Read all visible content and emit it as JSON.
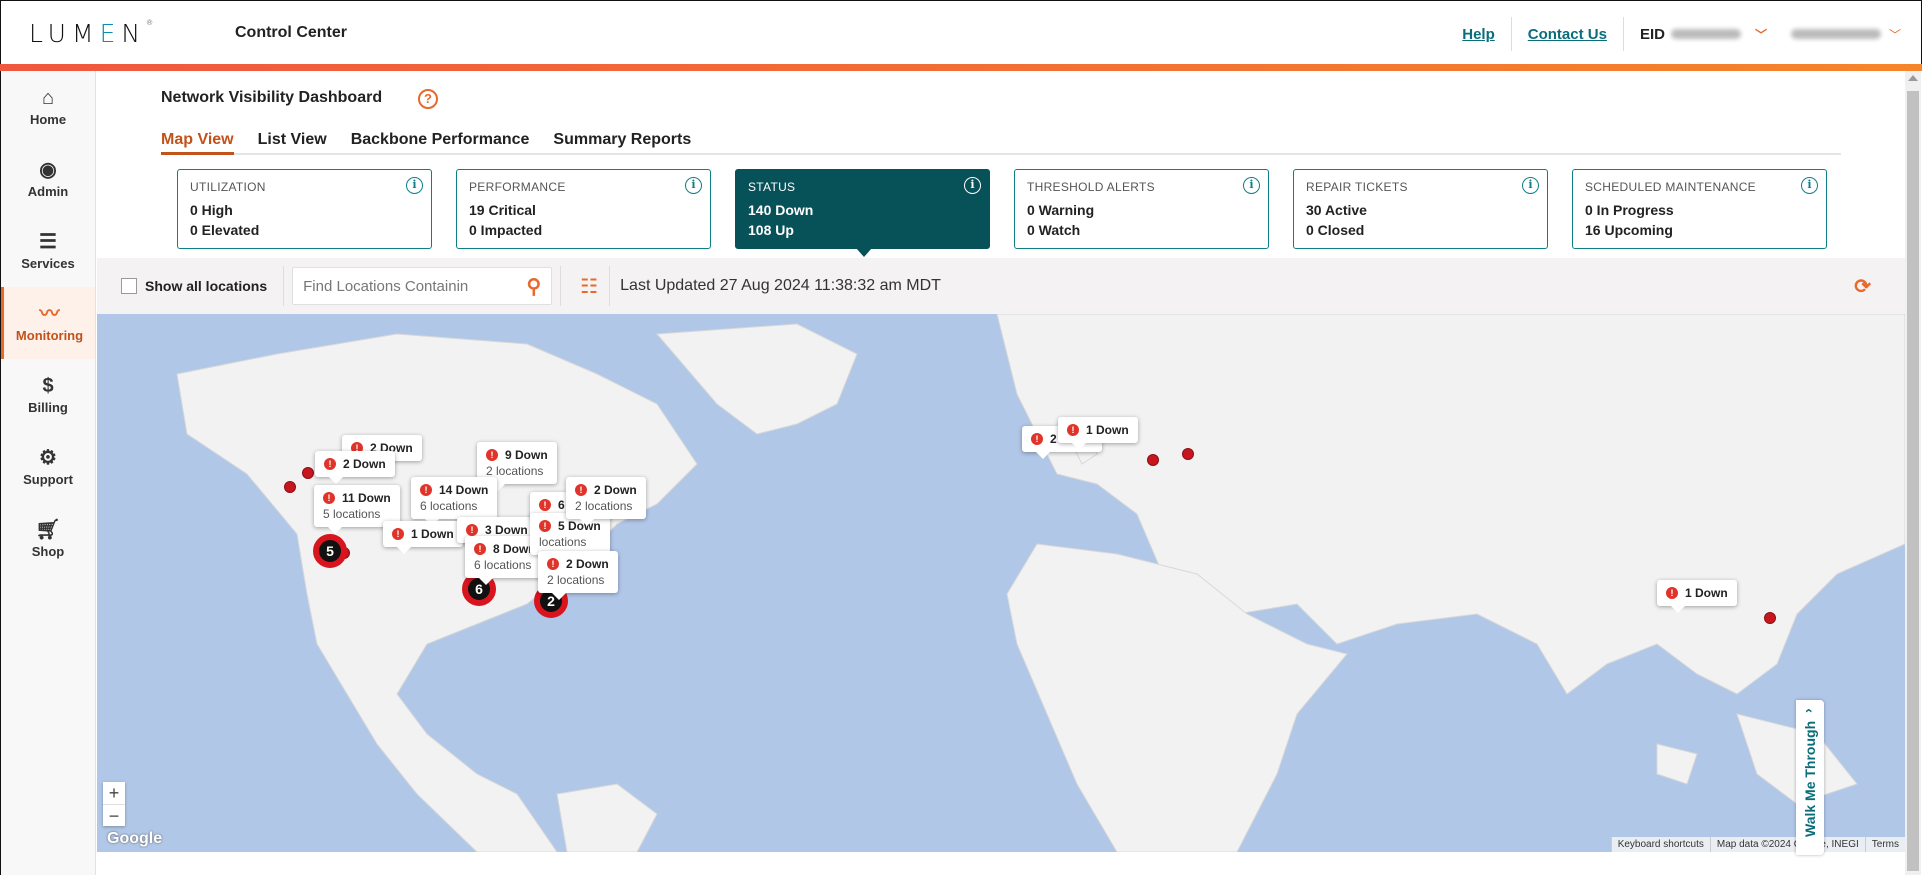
{
  "header": {
    "logo": "LUMEN",
    "app_title": "Control Center",
    "links": [
      "Help",
      "Contact Us"
    ],
    "eid_label": "EID"
  },
  "sidebar": {
    "items": [
      {
        "label": "Home",
        "icon": "home-icon"
      },
      {
        "label": "Admin",
        "icon": "user-circle-icon"
      },
      {
        "label": "Services",
        "icon": "list-icon"
      },
      {
        "label": "Monitoring",
        "icon": "pulse-icon",
        "active": true
      },
      {
        "label": "Billing",
        "icon": "invoice-icon"
      },
      {
        "label": "Support",
        "icon": "support-gear-icon"
      },
      {
        "label": "Shop",
        "icon": "cart-icon"
      }
    ]
  },
  "page": {
    "title": "Network Visibility Dashboard",
    "tabs": [
      "Map View",
      "List View",
      "Backbone Performance",
      "Summary Reports"
    ],
    "active_tab": "Map View"
  },
  "cards": [
    {
      "label": "UTILIZATION",
      "line1": "0 High",
      "line2": "0 Elevated"
    },
    {
      "label": "PERFORMANCE",
      "line1": "19 Critical",
      "line2": "0 Impacted"
    },
    {
      "label": "STATUS",
      "line1": "140 Down",
      "line2": "108 Up",
      "active": true
    },
    {
      "label": "THRESHOLD ALERTS",
      "line1": "0 Warning",
      "line2": "0 Watch"
    },
    {
      "label": "REPAIR TICKETS",
      "line1": "30 Active",
      "line2": "0 Closed"
    },
    {
      "label": "SCHEDULED MAINTENANCE",
      "line1": "0 In Progress",
      "line2": "16 Upcoming"
    }
  ],
  "toolbar": {
    "show_all_label": "Show all locations",
    "search_placeholder": "Find Locations Containin",
    "last_updated": "Last Updated 27 Aug 2024 11:38:32 am MDT"
  },
  "map": {
    "popups": [
      {
        "title": "2 Down",
        "sub": ""
      },
      {
        "title": "2 Down",
        "sub": ""
      },
      {
        "title": "11 Down",
        "sub": "5 locations"
      },
      {
        "title": "9 Down",
        "sub": "2 locations"
      },
      {
        "title": "14 Down",
        "sub": "6 locations"
      },
      {
        "title": "1 Down",
        "sub": ""
      },
      {
        "title": "3 Down",
        "sub": ""
      },
      {
        "title": "8 Down",
        "sub": "6 locations"
      },
      {
        "title": "6 Down",
        "sub": ""
      },
      {
        "title": "5 Down",
        "sub": "locations"
      },
      {
        "title": "2 Down",
        "sub": "2 locations"
      },
      {
        "title": "2 Down",
        "sub": "2 locations"
      },
      {
        "title": "2 Down",
        "sub": ""
      },
      {
        "title": "1 Down",
        "sub": ""
      },
      {
        "title": "1 Down",
        "sub": ""
      }
    ],
    "clusters": [
      "5",
      "6",
      "2"
    ],
    "zoom_in": "+",
    "zoom_out": "−",
    "brand": "Google",
    "attribution": [
      "Keyboard shortcuts",
      "Map data ©2024 Google, INEGI",
      "Terms"
    ]
  },
  "walkme": "Walk Me Through"
}
